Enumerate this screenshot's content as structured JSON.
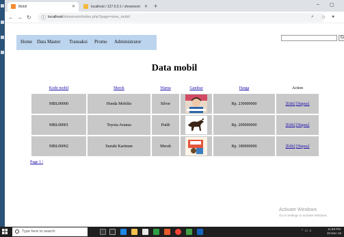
{
  "browser": {
    "tabs": [
      {
        "label": "Mobil",
        "active": true
      },
      {
        "label": "localhost / 127.0.0.1 / showroom",
        "active": false
      }
    ],
    "url_host": "localhost",
    "url_path": "/showroom/index.php?page=view_mobil"
  },
  "nav": {
    "items": [
      "Home",
      "Data Master",
      "Transaksi",
      "Promo",
      "Administrator"
    ],
    "search_button": "Ca"
  },
  "page": {
    "title": "Data mobil",
    "table": {
      "headers": [
        "Kode mobil",
        "Merek",
        "Warna",
        "Gambar",
        "Harga",
        "Action"
      ],
      "rows": [
        {
          "kode": "MBL00000",
          "merek": "Honda Mobilio",
          "warna": "Silver",
          "harga": "Rp. 230000000",
          "edit": "[Edit]",
          "hapus": "[Hapus]"
        },
        {
          "kode": "MBL00001",
          "merek": "Toyota Avanza",
          "warna": "Putih",
          "harga": "Rp. 200000000",
          "edit": "[Edit]",
          "hapus": "[Hapus]"
        },
        {
          "kode": "MBL00002",
          "merek": "Suzuki Karimun",
          "warna": "Merah",
          "harga": "Rp. 180000000",
          "edit": "[Edit]",
          "hapus": "[Hapus]"
        }
      ]
    },
    "pager": "Page 1 |"
  },
  "watermark": {
    "title": "Activate Windows",
    "subtitle": "Go to Settings to activate Windows."
  },
  "taskbar": {
    "search_placeholder": "Type here to search",
    "time": "11:58 PM",
    "date": "25-Dec-18"
  },
  "colors": {
    "nav_bg": "#bcd4ee",
    "cell_bg": "#c8c8c8",
    "link": "#1a0dab"
  }
}
